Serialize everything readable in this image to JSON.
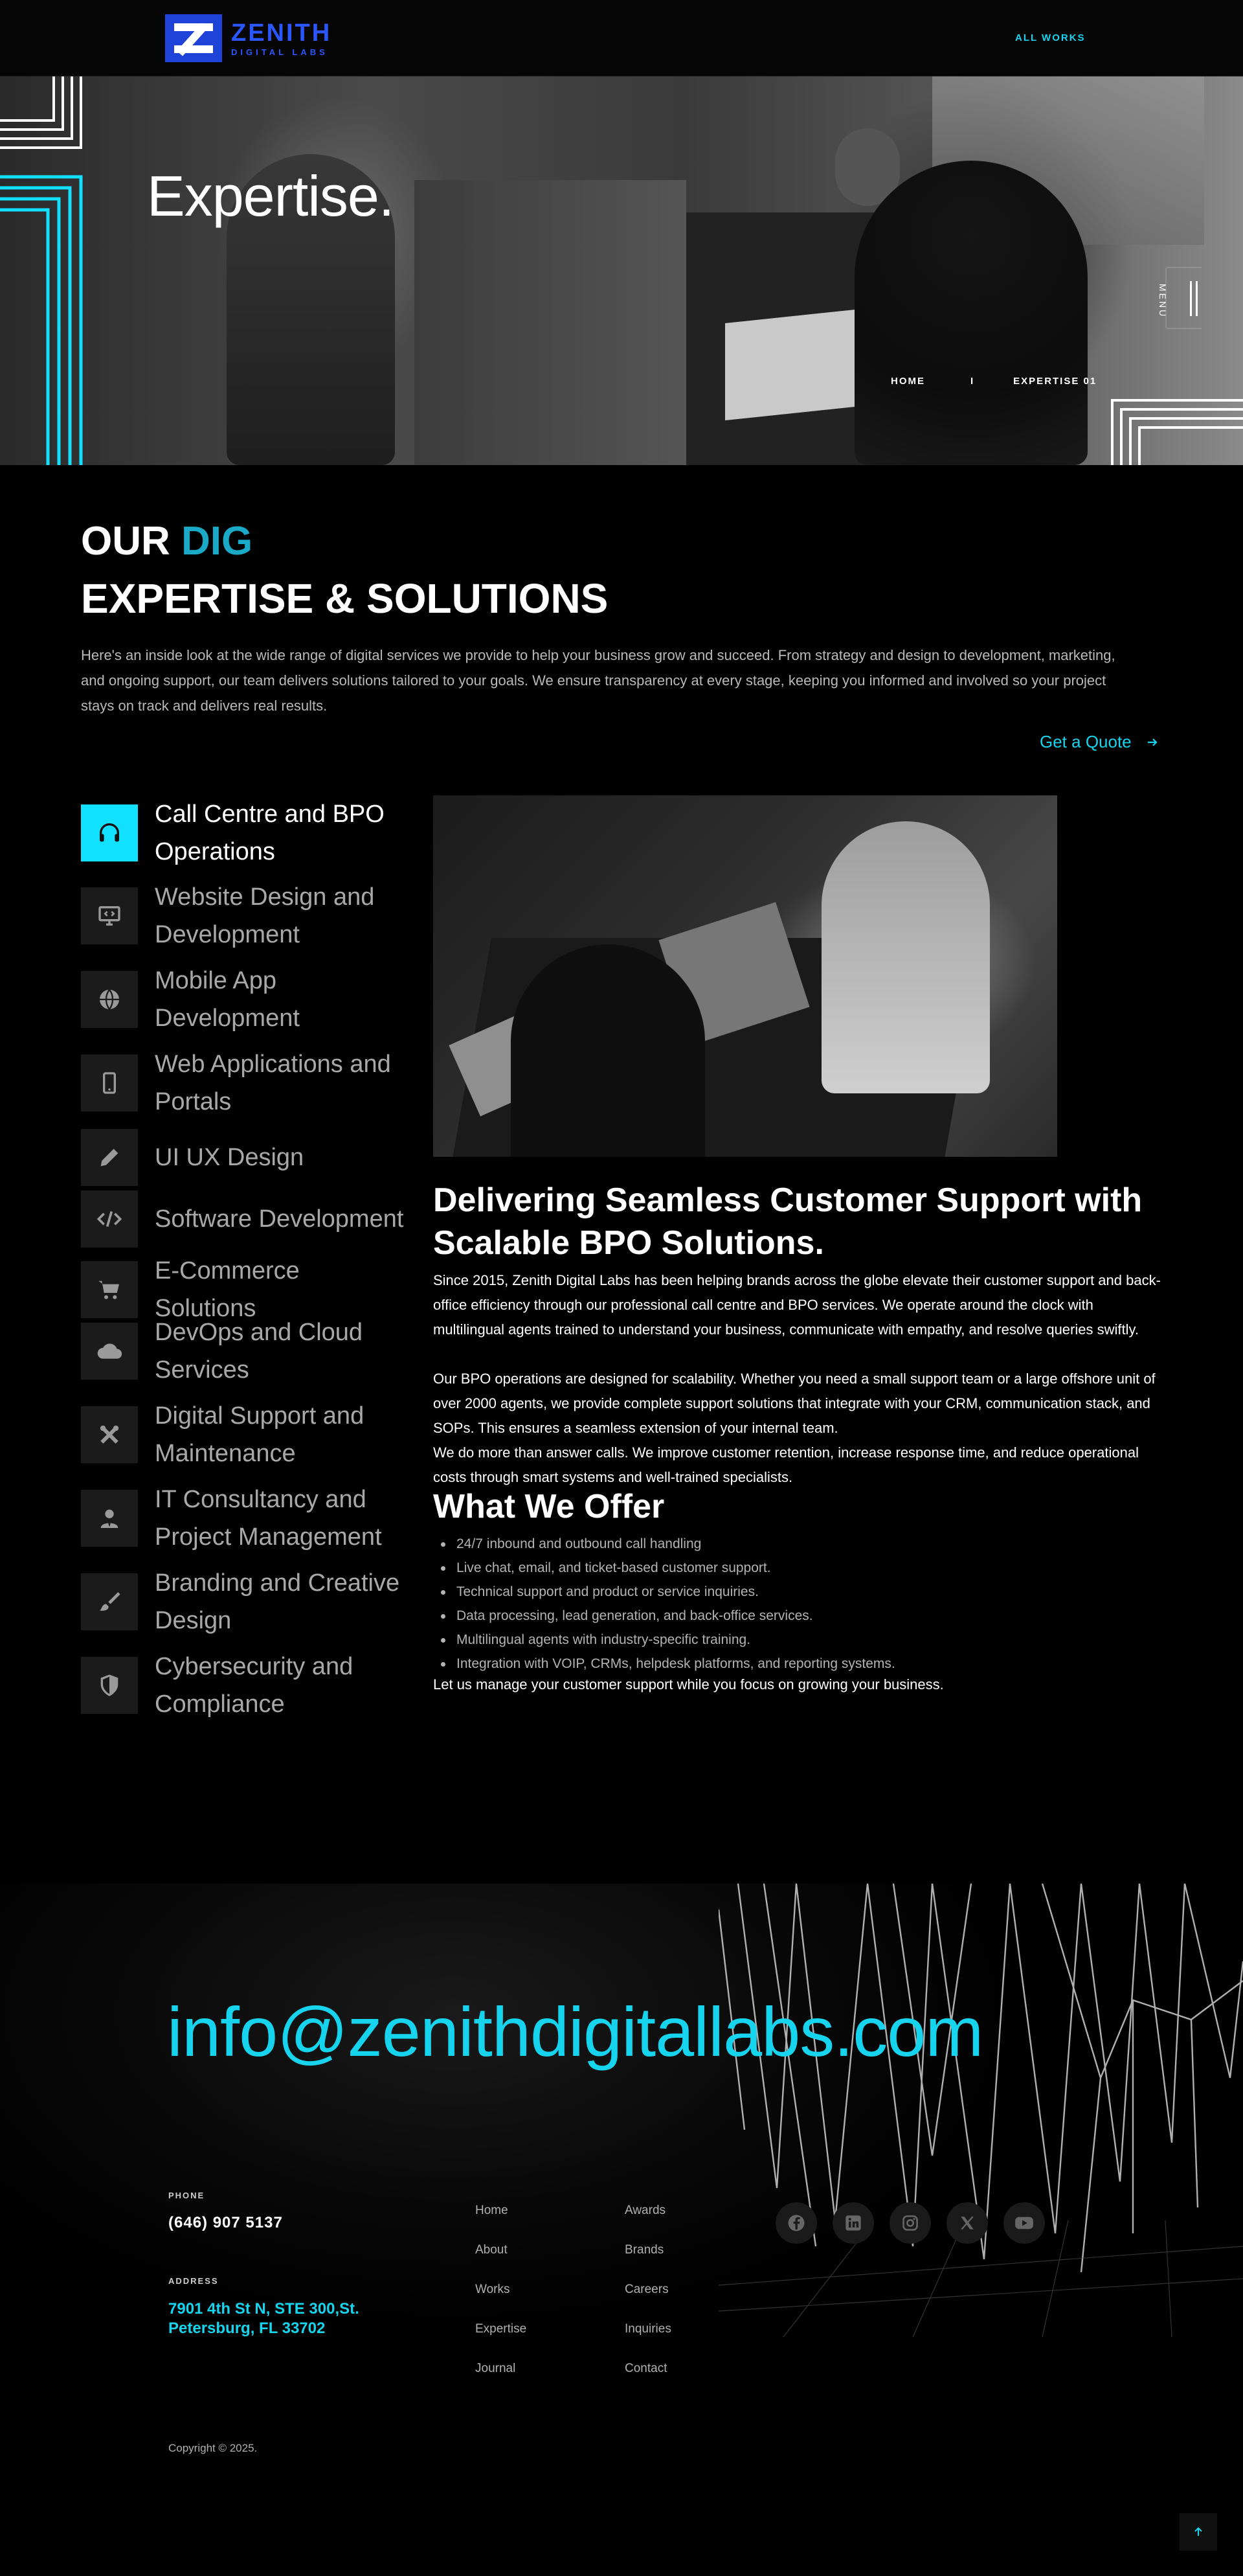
{
  "header": {
    "logo_name": "ZENITH",
    "logo_sub": "DIGITAL LABS",
    "all_works": "ALL WORKS"
  },
  "hero": {
    "title": "Expertise.",
    "menu_label": "MENU",
    "breadcrumb": {
      "home": "HOME",
      "separator": "I",
      "current": "EXPERTISE 01"
    }
  },
  "intro": {
    "line1_prefix": "OUR ",
    "line1_accent": "DIG",
    "line2": "EXPERTISE & SOLUTIONS",
    "paragraph": "Here's an inside look at the wide range of digital services we provide to help your business grow and succeed. From strategy and design to development, marketing, and ongoing support, our team delivers solutions tailored to your goals. We ensure transparency at every stage, keeping you informed and involved so your project stays on track and delivers real results.",
    "cta": "Get a Quote"
  },
  "services": [
    {
      "label": "Call Centre and BPO Operations",
      "icon": "headset-icon",
      "active": true
    },
    {
      "label": "Website Design and Development",
      "icon": "monitor-code-icon",
      "active": false
    },
    {
      "label": "Mobile App Development",
      "icon": "globe-icon",
      "active": false
    },
    {
      "label": "Web Applications and Portals",
      "icon": "mobile-icon",
      "active": false
    },
    {
      "label": "UI UX Design",
      "icon": "pencil-icon",
      "active": false
    },
    {
      "label": "Software Development",
      "icon": "code-icon",
      "active": false
    },
    {
      "label": "E-Commerce Solutions",
      "icon": "cart-icon",
      "active": false
    },
    {
      "label": "DevOps and Cloud Services",
      "icon": "cloud-icon",
      "active": false
    },
    {
      "label": "Digital Support and Maintenance",
      "icon": "tools-icon",
      "active": false
    },
    {
      "label": "IT Consultancy and Project Management",
      "icon": "user-tie-icon",
      "active": false
    },
    {
      "label": "Branding and Creative Design",
      "icon": "brush-icon",
      "active": false
    },
    {
      "label": "Cybersecurity and Compliance",
      "icon": "shield-icon",
      "active": false
    }
  ],
  "content": {
    "heading": "Delivering Seamless Customer Support with Scalable BPO Solutions.",
    "paragraphs": [
      "Since 2015, Zenith Digital Labs has been helping brands across the globe elevate their customer support and back-office efficiency through our professional call centre and BPO services. We operate around the clock with multilingual agents trained to understand your business, communicate with empathy, and resolve queries swiftly.",
      "Our BPO operations are designed for scalability. Whether you need a small support team or a large offshore unit of over 2000 agents, we provide complete support solutions that integrate with your CRM, communication stack, and SOPs. This ensures a seamless extension of your internal team.",
      "We do more than answer calls. We improve customer retention, increase response time, and reduce operational costs through smart systems and well-trained specialists."
    ],
    "offer_heading": "What We Offer",
    "offer_items": [
      "24/7 inbound and outbound call handling",
      "Live chat, email, and ticket-based customer support.",
      "Technical support and product or service inquiries.",
      "Data processing, lead generation, and back-office services.",
      "Multilingual agents with industry-specific training.",
      "Integration with VOIP, CRMs, helpdesk platforms, and reporting systems."
    ],
    "closing": "Let us manage your customer support while you focus on growing your business."
  },
  "footer": {
    "email": "info@zenithdigitallabs.com",
    "phone_label": "PHONE",
    "phone": "(646) 907 5137",
    "address_label": "ADDRESS",
    "address": "7901 4th St N, STE 300,St. Petersburg, FL 33702",
    "links_col1": [
      "Home",
      "About",
      "Works",
      "Expertise",
      "Journal"
    ],
    "links_col2": [
      "Awards",
      "Brands",
      "Careers",
      "Inquiries",
      "Contact"
    ],
    "socials": [
      "facebook-icon",
      "linkedin-icon",
      "instagram-icon",
      "x-icon",
      "youtube-icon"
    ],
    "copyright": "Copyright © 2025."
  },
  "colors": {
    "accent": "#16d4ee",
    "brand_blue": "#1f43d9",
    "background": "#000000"
  }
}
